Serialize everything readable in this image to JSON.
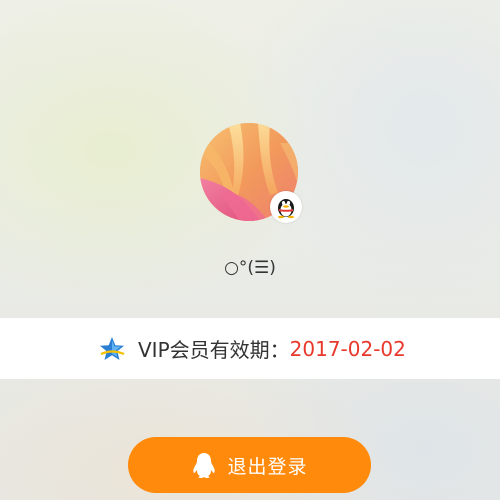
{
  "profile": {
    "avatar_icon": "flower-photo-avatar",
    "badge_icon": "qq-penguin-icon",
    "nickname": "○°(☰)"
  },
  "vip": {
    "icon": "star-icon",
    "label": "VIP会员有效期：",
    "expiry_date": "2017-02-02",
    "date_color": "#e8382b"
  },
  "logout": {
    "icon": "qq-penguin-icon",
    "label": "退出登录",
    "button_color": "#ff8a0b"
  }
}
